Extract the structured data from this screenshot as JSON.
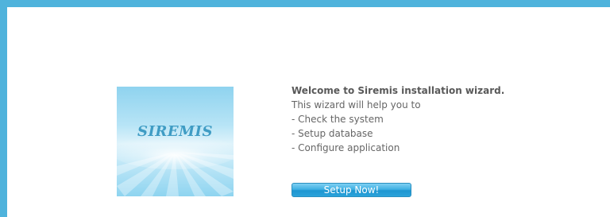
{
  "logo": {
    "text": "SIREMIS"
  },
  "intro": {
    "welcome": "Welcome to Siremis installation wizard.",
    "subtitle": "This wizard will help you to",
    "steps": [
      "- Check the system",
      "- Setup database",
      "- Configure application"
    ]
  },
  "actions": {
    "setup_label": "Setup Now!"
  },
  "colors": {
    "frame_border": "#4fb3dc",
    "button": "#2ba3da",
    "text": "#666666"
  }
}
